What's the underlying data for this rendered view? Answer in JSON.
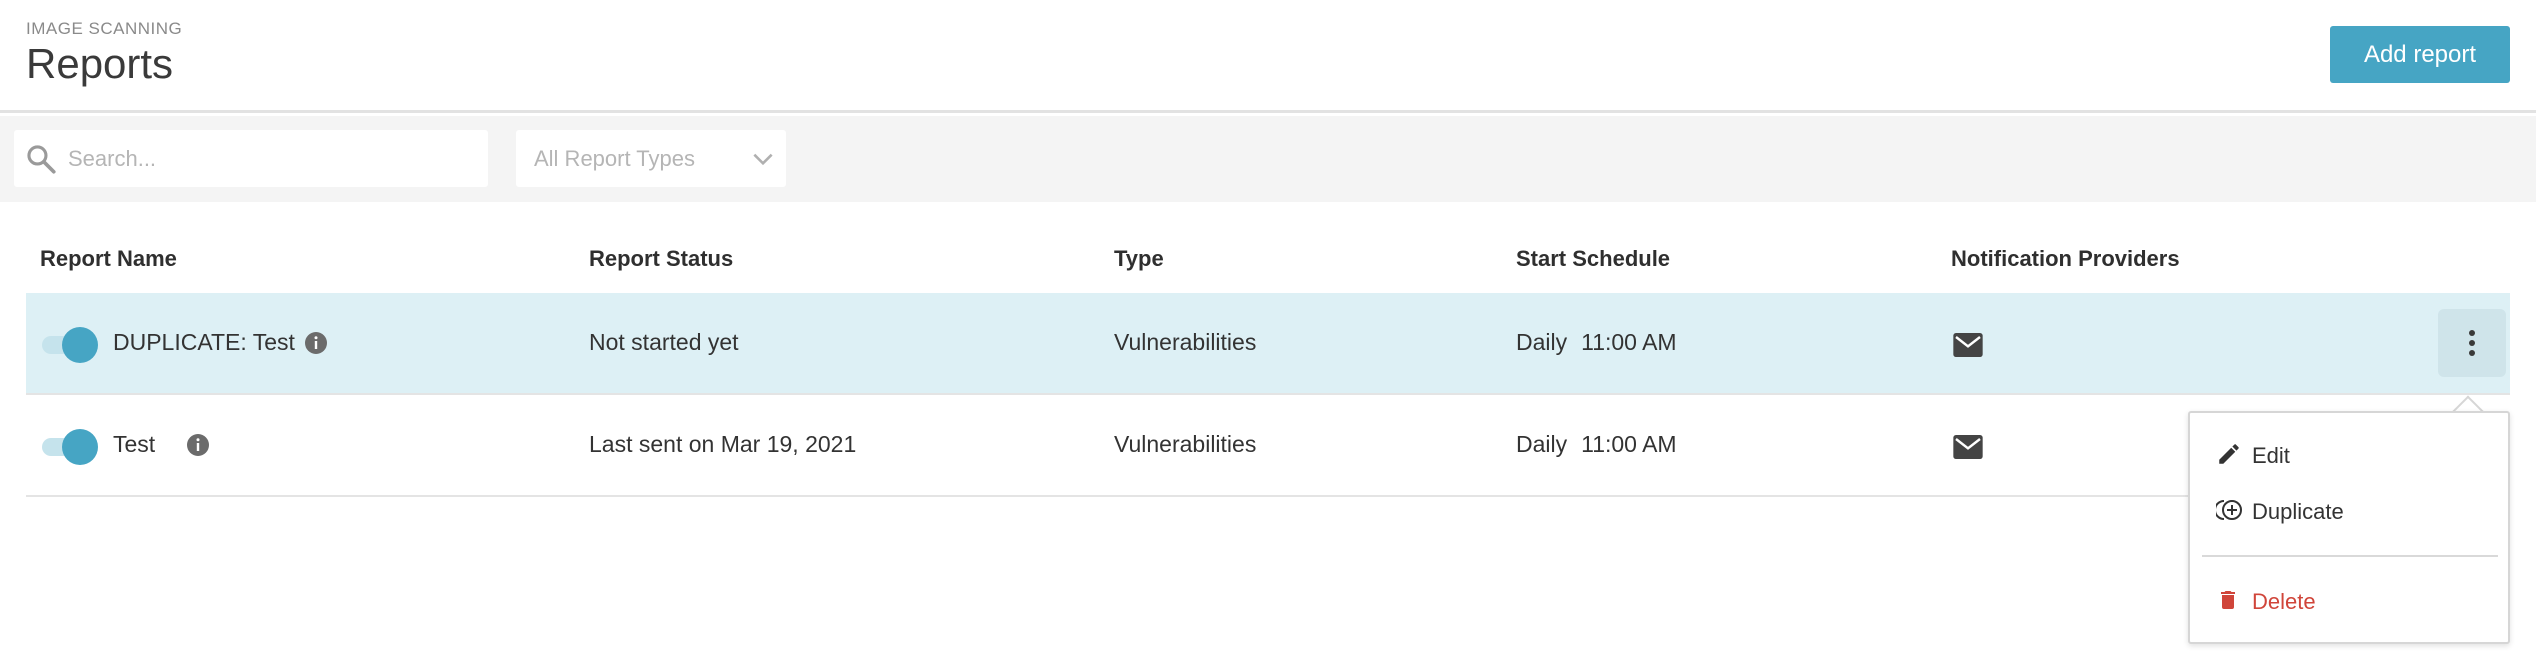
{
  "header": {
    "breadcrumb": "IMAGE SCANNING",
    "title": "Reports",
    "add_report_label": "Add report"
  },
  "filters": {
    "search_placeholder": "Search...",
    "report_type_selected": "All Report Types"
  },
  "table": {
    "columns": [
      "Report Name",
      "Report Status",
      "Type",
      "Start Schedule",
      "Notification Providers"
    ],
    "rows": [
      {
        "name": "DUPLICATE: Test",
        "enabled": true,
        "status": "Not started yet",
        "type": "Vulnerabilities",
        "schedule_frequency": "Daily",
        "schedule_time": "11:00 AM",
        "notification_icon": "mail-icon",
        "selected": true
      },
      {
        "name": "Test",
        "enabled": true,
        "status": "Last sent on Mar 19, 2021",
        "type": "Vulnerabilities",
        "schedule_frequency": "Daily",
        "schedule_time": "11:00 AM",
        "notification_icon": "mail-icon",
        "selected": false
      }
    ]
  },
  "menu": {
    "items": [
      {
        "label": "Edit",
        "icon": "pencil-icon"
      },
      {
        "label": "Duplicate",
        "icon": "duplicate-icon"
      },
      {
        "label": "Delete",
        "icon": "trash-icon"
      }
    ]
  },
  "colors": {
    "accent": "#46a5c4",
    "selected_row": "#ddf0f5",
    "danger": "#d0453a"
  }
}
